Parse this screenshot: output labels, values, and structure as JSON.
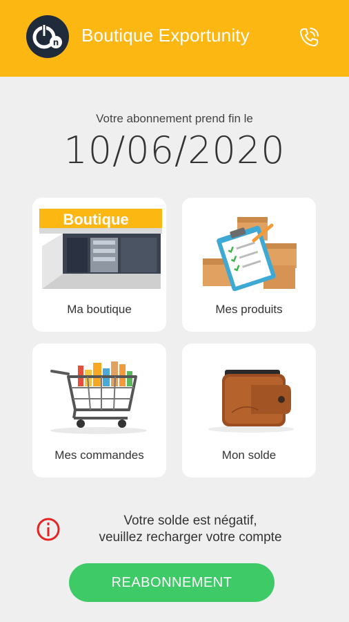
{
  "header": {
    "title": "Boutique Exportunity",
    "logo_text": "On",
    "phone_icon": "phone-icon"
  },
  "subscription": {
    "caption": "Votre abonnement prend fin le",
    "end_date": "10/06/2020"
  },
  "tiles": [
    {
      "label": "Ma boutique",
      "icon": "storefront-icon",
      "sign_text": "Boutique"
    },
    {
      "label": "Mes produits",
      "icon": "boxes-checklist-icon"
    },
    {
      "label": "Mes commandes",
      "icon": "shopping-cart-icon"
    },
    {
      "label": "Mon solde",
      "icon": "wallet-icon"
    }
  ],
  "alert": {
    "icon": "info-icon",
    "line1": "Votre solde est négatif,",
    "line2": "veuillez recharger votre compte"
  },
  "actions": {
    "renew_label": "REABONNEMENT"
  },
  "colors": {
    "appbar": "#fdb713",
    "background": "#efefef",
    "button": "#3ecb67",
    "alert_red": "#e52421",
    "logo_bg": "#1f2a3a"
  }
}
